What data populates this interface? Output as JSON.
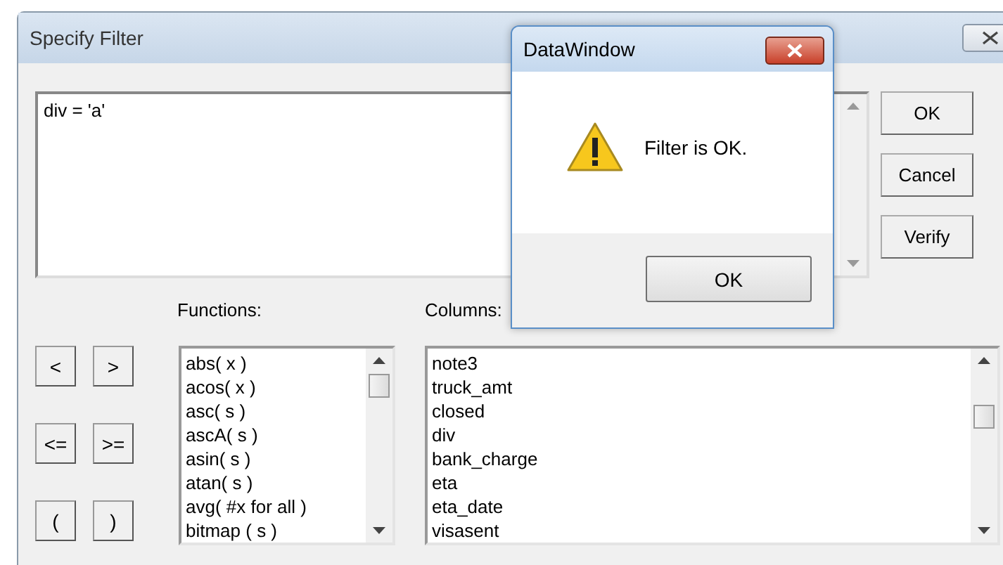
{
  "window": {
    "title": "Specify Filter"
  },
  "filter": {
    "value": "div = 'a'"
  },
  "buttons": [
    "OK",
    "Cancel",
    "Verify"
  ],
  "operators": [
    "<",
    ">",
    "<=",
    ">=",
    "(",
    ")"
  ],
  "functions": {
    "label": "Functions:",
    "items": [
      "abs( x )",
      "acos( x )",
      "asc( s )",
      "ascA( s )",
      "asin( s )",
      "atan( s )",
      "avg( #x for all )",
      "bitmap ( s )"
    ]
  },
  "columns": {
    "label": "Columns:",
    "items": [
      "note3",
      "truck_amt",
      "closed",
      "div",
      "bank_charge",
      "eta",
      "eta_date",
      "visasent"
    ]
  },
  "dialog": {
    "title": "DataWindow",
    "message": "Filter is OK.",
    "button": "OK"
  }
}
